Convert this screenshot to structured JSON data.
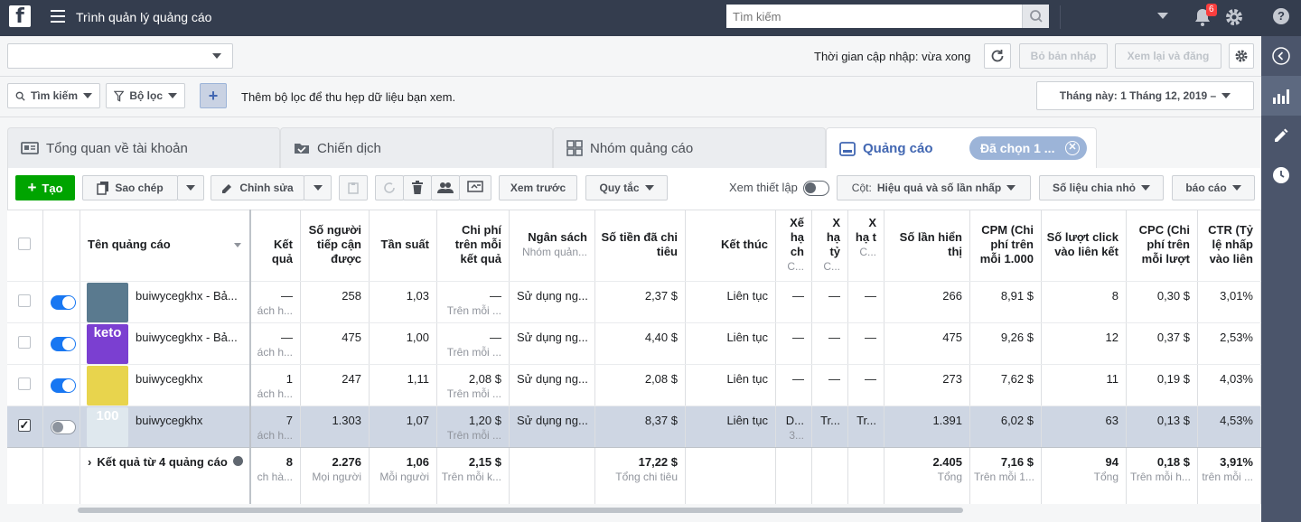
{
  "topbar": {
    "logo": "f",
    "app_title": "Trình quản lý quảng cáo",
    "search_placeholder": "Tìm kiếm",
    "notifications_count": "6",
    "help_label": "?"
  },
  "header": {
    "account_select_value": "",
    "update_text": "Thời gian cập nhập: vừa xong",
    "discard_label": "Bỏ bản nháp",
    "review_publish_label": "Xem lại và đăng"
  },
  "filterbar": {
    "search_label": "Tìm kiếm",
    "filter_label": "Bộ lọc",
    "add_label": "+",
    "hint": "Thêm bộ lọc để thu hẹp dữ liệu bạn xem.",
    "date_range": "Tháng này: 1 Tháng 12, 2019 –"
  },
  "tabs": [
    {
      "label": "Tổng quan về tài khoản"
    },
    {
      "label": "Chiến dịch"
    },
    {
      "label": "Nhóm quảng cáo"
    },
    {
      "label": "Quảng cáo"
    }
  ],
  "selected_chip": "Đã chọn 1 ...",
  "toolbar": {
    "create": "Tạo",
    "duplicate": "Sao chép",
    "edit": "Chỉnh sửa",
    "preview": "Xem trước",
    "rules": "Quy tắc",
    "view_setup": "Xem thiết lập",
    "columns_prefix": "Cột:",
    "columns_value": "Hiệu quả và số lần nhấp",
    "breakdown": "Số liệu chia nhỏ",
    "reports": "báo cáo"
  },
  "columns": {
    "name": "Tên quảng cáo",
    "results": "Kết quả",
    "reach": "Số người tiếp cận được",
    "frequency": "Tần suất",
    "cost_per_result": "Chi phí trên mỗi kết quả",
    "budget": "Ngân sách",
    "budget_sub": "Nhóm quản...",
    "spent": "Số tiền đã chi tiêu",
    "ends": "Kết thúc",
    "q1": "Xế hạ ch",
    "q1_sub": "C...",
    "q2": "X hạ tỷ",
    "q2_sub": "C...",
    "q3": "X hạ t",
    "q3_sub": "C...",
    "impressions": "Số lần hiển thị",
    "cpm": "CPM (Chi phí trên mỗi 1.000",
    "link_clicks": "Số lượt click vào liên kết",
    "cpc": "CPC (Chi phí trên mỗi lượt",
    "ctr": "CTR (Tỷ lệ nhấp vào liên"
  },
  "rows": [
    {
      "name": "buiwycegkhx - Bả...",
      "status": "on",
      "checked": false,
      "results": "—",
      "results_sub": "ách h...",
      "reach": "258",
      "freq": "1,03",
      "cpr": "—",
      "cpr_sub": "Trên mỗi ...",
      "budget": "Sử dụng ng...",
      "spent": "2,37 $",
      "ends": "Liên tục",
      "q1": "—",
      "q1_sub": "",
      "q2": "—",
      "q3": "—",
      "impr": "266",
      "cpm": "8,91 $",
      "clicks": "8",
      "cpc": "0,30 $",
      "ctr": "3,01%"
    },
    {
      "name": "buiwycegkhx - Bả...",
      "status": "on",
      "checked": false,
      "results": "—",
      "results_sub": "ách h...",
      "reach": "475",
      "freq": "1,00",
      "cpr": "—",
      "cpr_sub": "Trên mỗi ...",
      "budget": "Sử dụng ng...",
      "spent": "4,40 $",
      "ends": "Liên tục",
      "q1": "—",
      "q1_sub": "",
      "q2": "—",
      "q3": "—",
      "impr": "475",
      "cpm": "9,26 $",
      "clicks": "12",
      "cpc": "0,37 $",
      "ctr": "2,53%"
    },
    {
      "name": "buiwycegkhx",
      "status": "on",
      "checked": false,
      "results": "1",
      "results_sub": "ách h...",
      "reach": "247",
      "freq": "1,11",
      "cpr": "2,08 $",
      "cpr_sub": "Trên mỗi ...",
      "budget": "Sử dụng ng...",
      "spent": "2,08 $",
      "ends": "Liên tục",
      "q1": "—",
      "q1_sub": "",
      "q2": "—",
      "q3": "—",
      "impr": "273",
      "cpm": "7,62 $",
      "clicks": "11",
      "cpc": "0,19 $",
      "ctr": "4,03%"
    },
    {
      "name": "buiwycegkhx",
      "status": "off",
      "checked": true,
      "results": "7",
      "results_sub": "ách h...",
      "reach": "1.303",
      "freq": "1,07",
      "cpr": "1,20 $",
      "cpr_sub": "Trên mỗi ...",
      "budget": "Sử dụng ng...",
      "spent": "8,37 $",
      "ends": "Liên tục",
      "q1": "D...",
      "q1_sub": "3...",
      "q2": "Tr...",
      "q3": "Tr...",
      "impr": "1.391",
      "cpm": "6,02 $",
      "clicks": "63",
      "cpc": "0,13 $",
      "ctr": "4,53%"
    }
  ],
  "totals": {
    "label": "Kết quả từ 4 quảng cáo",
    "results": "8",
    "results_sub": "ch hà...",
    "reach": "2.276",
    "reach_sub": "Mọi người",
    "freq": "1,06",
    "freq_sub": "Mỗi người",
    "cpr": "2,15 $",
    "cpr_sub": "Trên mỗi k...",
    "spent": "17,22 $",
    "spent_sub": "Tổng chi tiêu",
    "impr": "2.405",
    "impr_sub": "Tổng",
    "cpm": "7,16 $",
    "cpm_sub": "Trên mỗi 1...",
    "clicks": "94",
    "clicks_sub": "Tổng",
    "cpc": "0,18 $",
    "cpc_sub": "Trên mỗi h...",
    "ctr": "3,91%",
    "ctr_sub": "trên mỗi ..."
  },
  "thumb_texts": [
    "",
    "keto",
    "",
    "100"
  ],
  "colors": {
    "topbar": "#343d4e",
    "accent": "#4267b2",
    "create": "#00a400",
    "toggle_on": "#1877f2",
    "rail": "#4b556b"
  },
  "icons": {
    "right_rail": [
      "collapse-icon",
      "chart-icon",
      "pencil-icon",
      "history-icon"
    ]
  }
}
